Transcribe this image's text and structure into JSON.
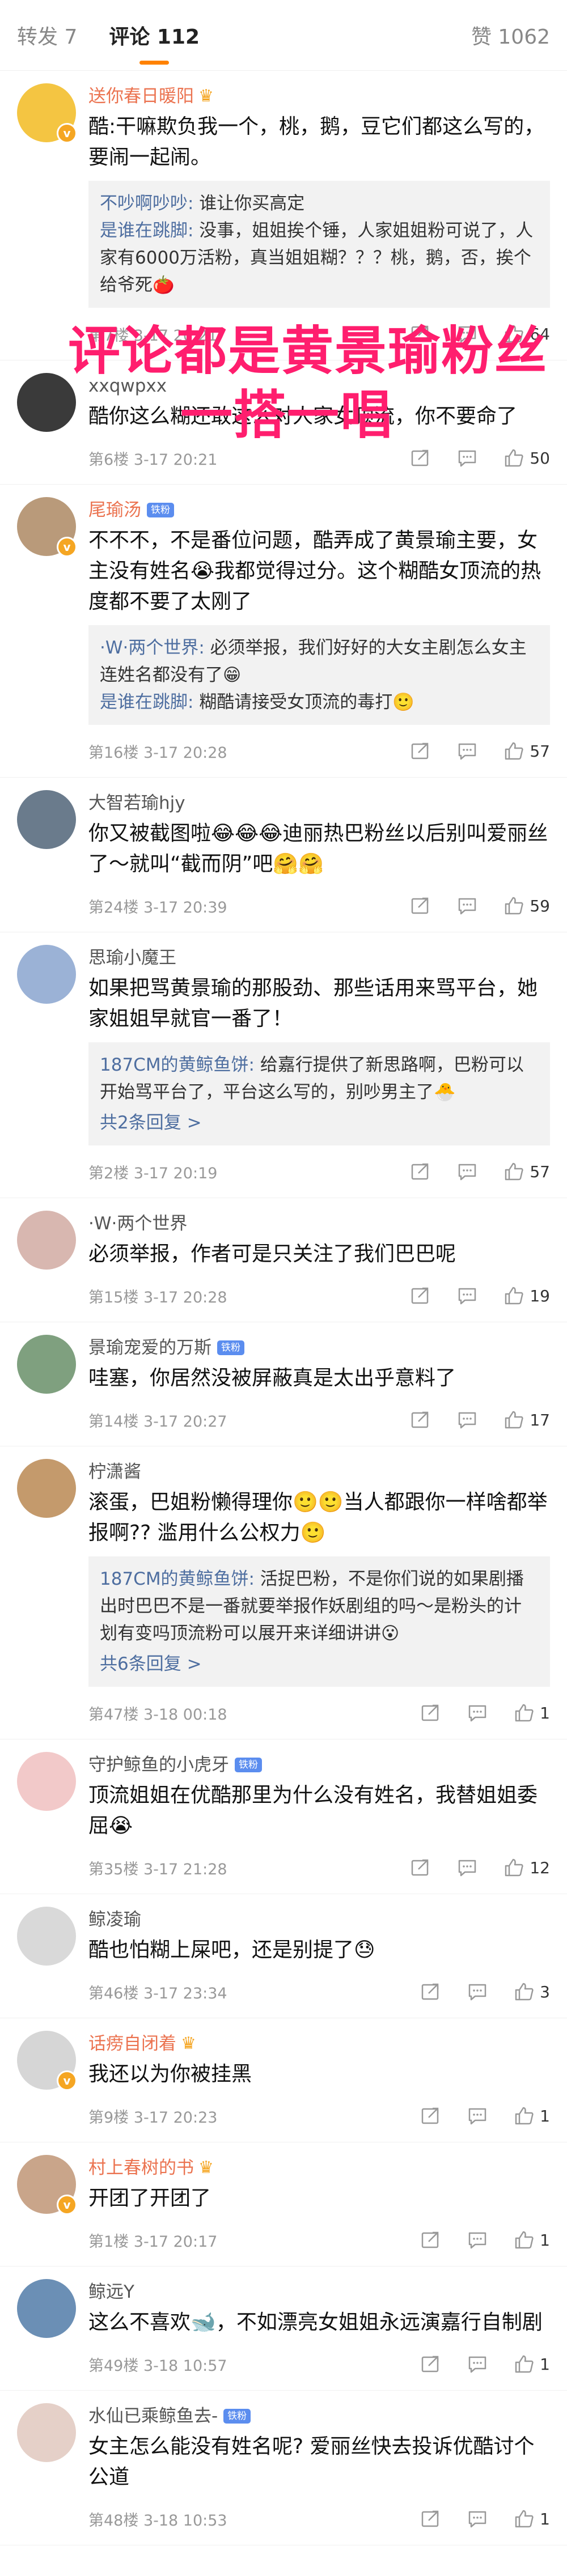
{
  "topbar": {
    "repost": "转发 7",
    "comments": "评论 112",
    "likes": "赞 1062"
  },
  "overlay": {
    "line1": "评论都是黄景瑜粉丝",
    "line2": "一搭一唱"
  },
  "colors": {
    "accent": "#ff8200",
    "overlay": "#ff1e6e",
    "reply_name": "#4e6ea0",
    "orange_name": "#eb7350"
  },
  "comments": [
    {
      "user": "送你春日暖阳",
      "name_color": "orange",
      "badge": "crown",
      "text": "酷:干嘛欺负我一个，桃，鹅，豆它们都这么写的，要闹一起闹。",
      "replies": [
        {
          "name": "不吵啊吵吵:",
          "text": " 谁让你买高定"
        },
        {
          "name": "是谁在跳脚:",
          "text": " 没事，姐姐挨个锤，人家姐姐粉可说了，人家有6000万活粉，真当姐姐糊？？？桃，鹅，否，挨个给爷死🍅"
        }
      ],
      "more": "",
      "meta": "第7楼 3-17 20:21",
      "like_count": "64"
    },
    {
      "user": "xxqwpxx",
      "name_color": "gray",
      "badge": "",
      "text": "酷你这么糊还敢这么对人家女顶流，你不要命了",
      "replies": [],
      "more": "",
      "meta": "第6楼 3-17 20:21",
      "like_count": "50"
    },
    {
      "user": "尾瑜汤",
      "name_color": "orange",
      "badge": "lvl",
      "text": "不不不，不是番位问题，酷弄成了黄景瑜主要，女主没有姓名😭我都觉得过分。这个糊酷女顶流的热度都不要了太刚了",
      "replies": [
        {
          "name": "·W·两个世界:",
          "text": " 必须举报，我们好好的大女主剧怎么女主连姓名都没有了😁"
        },
        {
          "name": "是谁在跳脚:",
          "text": " 糊酷请接受女顶流的毒打🙂"
        }
      ],
      "more": "",
      "meta": "第16楼 3-17 20:28",
      "like_count": "57"
    },
    {
      "user": "大智若瑜hjy",
      "name_color": "gray",
      "badge": "",
      "text": "你又被截图啦😂😂😂迪丽热巴粉丝以后别叫爱丽丝了～就叫“截而阴”吧🤗🤗",
      "replies": [],
      "more": "",
      "meta": "第24楼 3-17 20:39",
      "like_count": "59"
    },
    {
      "user": "思瑜小魔王",
      "name_color": "gray",
      "badge": "",
      "text": "如果把骂黄景瑜的那股劲、那些话用来骂平台，她家姐姐早就官一番了！",
      "replies": [
        {
          "name": "187CM的黄鲸鱼饼:",
          "text": " 给嘉行提供了新思路啊，巴粉可以开始骂平台了，平台这么写的，别吵男主了🐣"
        }
      ],
      "more": "共2条回复 >",
      "meta": "第2楼 3-17 20:19",
      "like_count": "57"
    },
    {
      "user": "·W·两个世界",
      "name_color": "gray",
      "badge": "",
      "text": "必须举报，作者可是只关注了我们巴巴呢",
      "replies": [],
      "more": "",
      "meta": "第15楼 3-17 20:28",
      "like_count": "19"
    },
    {
      "user": "景瑜宠爱的万斯",
      "name_color": "gray",
      "badge": "lvl",
      "text": "哇塞，你居然没被屏蔽真是太出乎意料了",
      "replies": [],
      "more": "",
      "meta": "第14楼 3-17 20:27",
      "like_count": "17"
    },
    {
      "user": "柠潇酱",
      "name_color": "gray",
      "badge": "",
      "text": "滚蛋，巴姐粉懒得理你🙂🙂当人都跟你一样啥都举报啊?? 滥用什么公权力🙂",
      "replies": [
        {
          "name": "187CM的黄鲸鱼饼:",
          "text": " 活捉巴粉，不是你们说的如果剧播出时巴巴不是一番就要举报作妖剧组的吗～是粉头的计划有变吗顶流粉可以展开来详细讲讲😮"
        }
      ],
      "more": "共6条回复 >",
      "meta": "第47楼 3-18 00:18",
      "like_count": "1"
    },
    {
      "user": "守护鲸鱼的小虎牙",
      "name_color": "gray",
      "badge": "lvl",
      "text": "顶流姐姐在优酷那里为什么没有姓名，我替姐姐委屈😭",
      "replies": [],
      "more": "",
      "meta": "第35楼 3-17 21:28",
      "like_count": "12"
    },
    {
      "user": "鲸凌瑜",
      "name_color": "gray",
      "badge": "",
      "text": "酷也怕糊上屎吧，还是别提了😓",
      "replies": [],
      "more": "",
      "meta": "第46楼 3-17 23:34",
      "like_count": "3"
    },
    {
      "user": "话痨自闭着",
      "name_color": "orange",
      "badge": "crown",
      "text": "我还以为你被挂黑",
      "replies": [],
      "more": "",
      "meta": "第9楼 3-17 20:23",
      "like_count": "1"
    },
    {
      "user": "村上春树的书",
      "name_color": "orange",
      "badge": "crown",
      "text": "开团了开团了",
      "replies": [],
      "more": "",
      "meta": "第1楼 3-17 20:17",
      "like_count": "1"
    },
    {
      "user": "鲸远Y",
      "name_color": "gray",
      "badge": "",
      "text": "这么不喜欢🐋，不如漂亮女姐姐永远演嘉行自制剧",
      "replies": [],
      "more": "",
      "meta": "第49楼 3-18 10:57",
      "like_count": "1"
    },
    {
      "user": "水仙已乘鲸鱼去-",
      "name_color": "gray",
      "badge": "lvl",
      "text": "女主怎么能没有姓名呢? 爱丽丝快去投诉优酷讨个公道",
      "replies": [],
      "more": "",
      "meta": "第48楼 3-18 10:53",
      "like_count": "1"
    }
  ],
  "icons": {
    "share": "share-icon",
    "comment": "comment-icon",
    "like": "like-icon"
  }
}
